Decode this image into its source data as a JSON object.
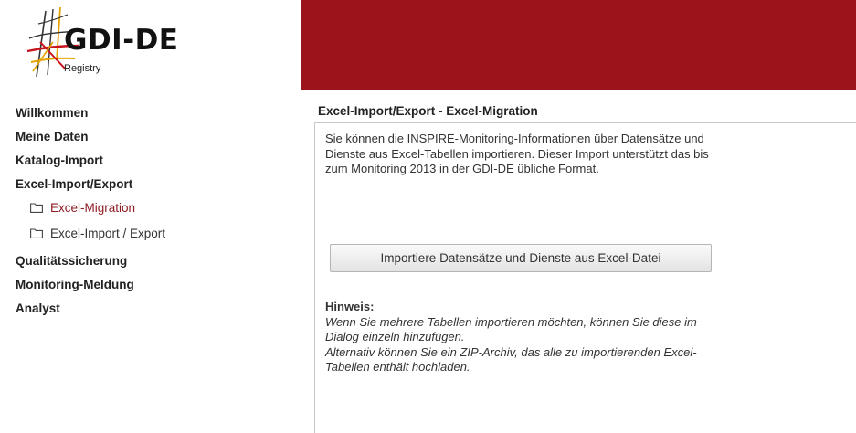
{
  "brand": {
    "logo_text": "GDI-DE",
    "logo_subtitle": "Registry",
    "banner_color": "#9b141b",
    "accent_color": "#8f1d24"
  },
  "sidebar": {
    "items": [
      {
        "label": "Willkommen"
      },
      {
        "label": "Meine Daten"
      },
      {
        "label": "Katalog-Import"
      },
      {
        "label": "Excel-Import/Export"
      },
      {
        "label": "Excel-Migration",
        "icon": "folder-icon",
        "active": true
      },
      {
        "label": "Excel-Import / Export",
        "icon": "folder-icon"
      },
      {
        "label": "Qualitätssicherung"
      },
      {
        "label": "Monitoring-Meldung"
      },
      {
        "label": "Analyst"
      }
    ]
  },
  "main": {
    "title": "Excel-Import/Export - Excel-Migration",
    "intro": "Sie können die INSPIRE-Monitoring-Informationen über Datensätze und Dienste aus Excel-Tabellen importieren. Dieser Import unterstützt das bis zum Monitoring 2013 in der GDI-DE übliche Format.",
    "import_button": "Importiere Datensätze und Dienste aus Excel-Datei",
    "hint_title": "Hinweis:",
    "hint_lines": [
      "Wenn Sie mehrere Tabellen importieren möchten, können Sie diese im Dialog einzeln hinzufügen.",
      "Alternativ können Sie ein ZIP-Archiv, das alle zu importierenden Excel-Tabellen enthält hochladen."
    ]
  }
}
